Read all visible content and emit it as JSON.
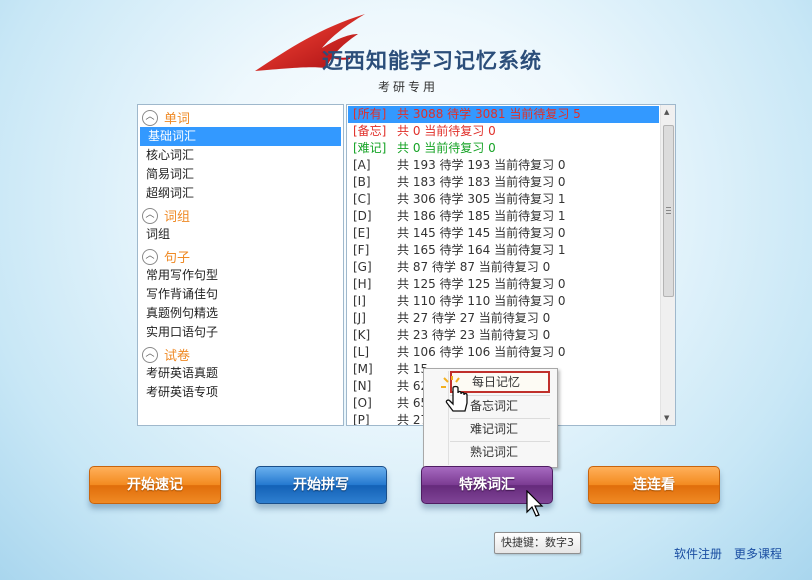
{
  "app": {
    "title": "迈西知能学习记忆系统",
    "subtitle": "考研专用"
  },
  "left_panel": {
    "groups": [
      {
        "title": "单词",
        "items": [
          "基础词汇",
          "核心词汇",
          "简易词汇",
          "超纲词汇"
        ],
        "selected": 0
      },
      {
        "title": "词组",
        "items": [
          "词组"
        ]
      },
      {
        "title": "句子",
        "items": [
          "常用写作句型",
          "写作背诵佳句",
          "真题例句精选",
          "实用口语句子"
        ]
      },
      {
        "title": "试卷",
        "items": [
          "考研英语真题",
          "考研英语专项"
        ]
      }
    ]
  },
  "right_panel": {
    "rows": [
      {
        "tag": "[所有]",
        "text": "共 3088 待学 3081 当前待复习 5",
        "color": "#e0302a",
        "selected": true
      },
      {
        "tag": "[备忘]",
        "text": "共 0  当前待复习 0",
        "color": "#e0302a"
      },
      {
        "tag": "[难记]",
        "text": "共 0  当前待复习 0",
        "color": "#16a326"
      },
      {
        "tag": "[A]",
        "text": "共 193 待学 193 当前待复习 0"
      },
      {
        "tag": "[B]",
        "text": "共 183 待学 183 当前待复习 0"
      },
      {
        "tag": "[C]",
        "text": "共 306 待学 305 当前待复习 1"
      },
      {
        "tag": "[D]",
        "text": "共 186 待学 185 当前待复习 1"
      },
      {
        "tag": "[E]",
        "text": "共 145 待学 145 当前待复习 0"
      },
      {
        "tag": "[F]",
        "text": "共 165 待学 164 当前待复习 1"
      },
      {
        "tag": "[G]",
        "text": "共 87 待学 87 当前待复习 0"
      },
      {
        "tag": "[H]",
        "text": "共 125 待学 125 当前待复习 0"
      },
      {
        "tag": "[I]",
        "text": "共 110 待学 110 当前待复习 0"
      },
      {
        "tag": "[J]",
        "text": "共 27 待学 27 当前待复习 0"
      },
      {
        "tag": "[K]",
        "text": "共 23 待学 23 当前待复习 0"
      },
      {
        "tag": "[L]",
        "text": "共 106 待学 106 当前待复习 0"
      },
      {
        "tag": "[M]",
        "text": "共 15"
      },
      {
        "tag": "[N]",
        "text": "共 62"
      },
      {
        "tag": "[O]",
        "text": "共 65"
      },
      {
        "tag": "[P]",
        "text": "共 27"
      }
    ]
  },
  "context_menu": {
    "items": [
      "每日记忆",
      "备忘词汇",
      "难记词汇",
      "熟记词汇"
    ],
    "highlighted": 0
  },
  "buttons": {
    "start_memorize": "开始速记",
    "start_spelling": "开始拼写",
    "special_vocab": "特殊词汇",
    "match_game": "连连看"
  },
  "tooltip": "快捷键：数字3",
  "footer": {
    "register": "软件注册",
    "more_courses": "更多课程"
  },
  "colors": {
    "accent_orange": "#f08a24",
    "select_blue": "#3399ff",
    "brand_red": "#d6202a"
  }
}
